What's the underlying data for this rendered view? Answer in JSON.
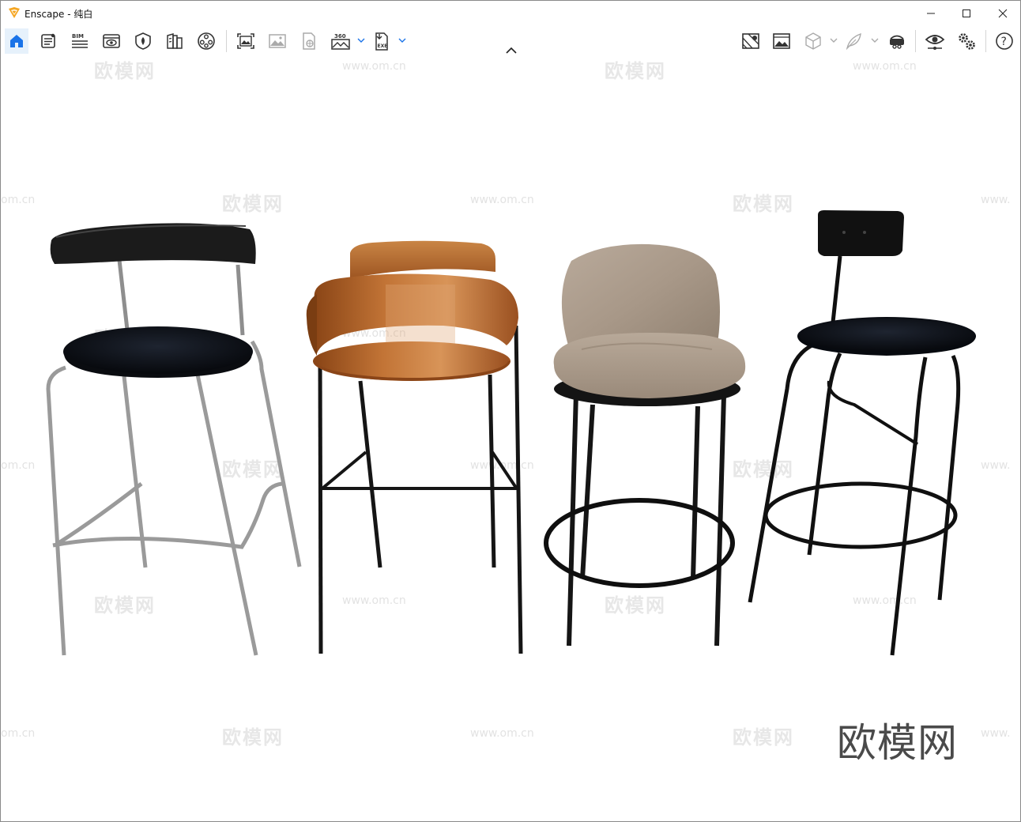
{
  "window": {
    "title": "Enscape - 纯白"
  },
  "toolbar": {
    "left_icons": [
      {
        "name": "home-icon"
      },
      {
        "name": "asset-library-icon"
      },
      {
        "name": "bim-icon",
        "label": "BIM"
      },
      {
        "name": "view-icon"
      },
      {
        "name": "material-icon"
      },
      {
        "name": "library-icon"
      },
      {
        "name": "video-editor-icon"
      },
      {
        "name": "screenshot-icon"
      },
      {
        "name": "batch-render-icon"
      },
      {
        "name": "web-standalone-icon"
      },
      {
        "name": "panorama-icon",
        "label": "360"
      },
      {
        "name": "exe-export-icon",
        "label": "EXE"
      }
    ],
    "right_icons": [
      {
        "name": "site-context-icon"
      },
      {
        "name": "atmosphere-icon"
      },
      {
        "name": "cube-icon"
      },
      {
        "name": "feather-icon"
      },
      {
        "name": "vr-headset-icon"
      },
      {
        "name": "visual-settings-icon"
      },
      {
        "name": "settings-icon"
      },
      {
        "name": "help-icon",
        "label": "?"
      }
    ]
  },
  "watermark": {
    "brand": "欧模网",
    "url": "www.om.cn",
    "url_partial": "om.cn",
    "url_cut": "www."
  }
}
